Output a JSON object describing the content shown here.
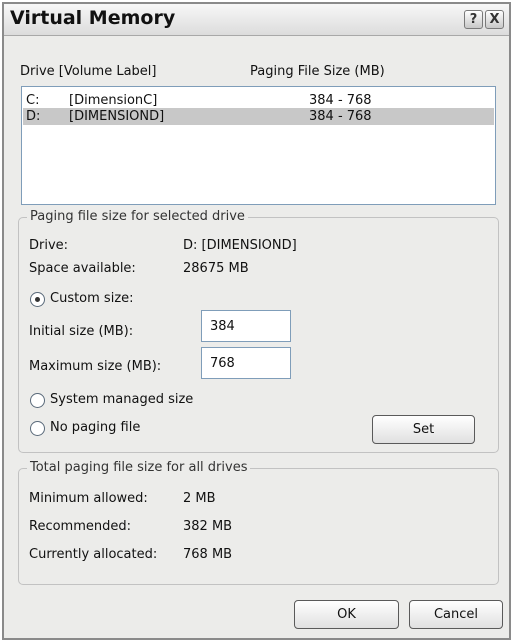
{
  "window": {
    "title": "Virtual Memory",
    "help_glyph": "?",
    "close_glyph": "X"
  },
  "drive_list": {
    "header_drive": "Drive  [Volume Label]",
    "header_size": "Paging File Size (MB)",
    "rows": [
      {
        "letter": "C:",
        "label": "[DimensionC]",
        "size": "384 - 768",
        "selected": false
      },
      {
        "letter": "D:",
        "label": "[DIMENSIOND]",
        "size": "384 - 768",
        "selected": true
      }
    ]
  },
  "selected_drive": {
    "group_title": "Paging file size for selected drive",
    "drive_label": "Drive:",
    "drive_value": "D:  [DIMENSIOND]",
    "space_label": "Space available:",
    "space_value": "28675 MB",
    "custom_size_label": "Custom size:",
    "initial_label": "Initial size (MB):",
    "initial_value": "384",
    "maximum_label": "Maximum size (MB):",
    "maximum_value": "768",
    "system_managed_label": "System managed size",
    "no_paging_label": "No paging file",
    "selected_option": "custom",
    "set_label": "Set"
  },
  "totals": {
    "group_title": "Total paging file size for all drives",
    "minimum_label": "Minimum allowed:",
    "minimum_value": "2 MB",
    "recommended_label": "Recommended:",
    "recommended_value": "382 MB",
    "allocated_label": "Currently allocated:",
    "allocated_value": "768 MB"
  },
  "buttons": {
    "ok": "OK",
    "cancel": "Cancel"
  }
}
